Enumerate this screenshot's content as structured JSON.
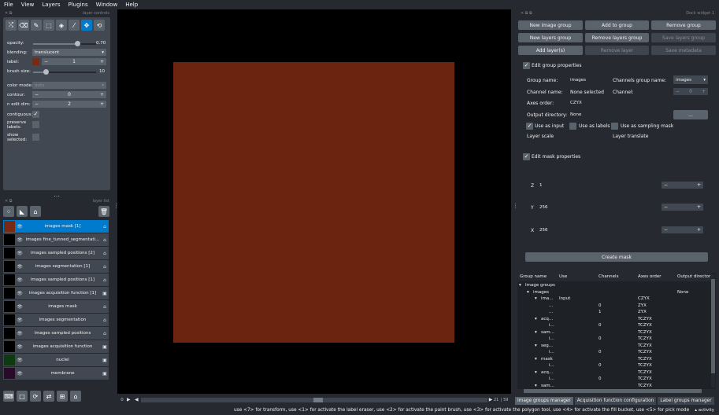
{
  "menu": [
    "File",
    "View",
    "Layers",
    "Plugins",
    "Window",
    "Help"
  ],
  "left": {
    "controls_title": "layer controls",
    "layers_title": "layer list",
    "opacity_label": "opacity:",
    "opacity_value": "0.70",
    "opacity_fraction": 0.7,
    "blending_label": "blending:",
    "blending_value": "translucent",
    "label_label": "label:",
    "label_value": "1",
    "label_color": "#7a2a12",
    "brush_label": "brush size:",
    "brush_value": "10",
    "brush_fraction": 0.2,
    "colormode_label": "color mode:",
    "colormode_value": "auto",
    "contour_label": "contour:",
    "contour_value": "0",
    "ndim_label": "n edit dim:",
    "ndim_value": "2",
    "contiguous_label": "contiguous:",
    "preserve_label": "preserve labels:",
    "show_label": "show selected:",
    "layers": [
      {
        "name": "images mask [1]",
        "type": "labels",
        "thumb": "#7a2a12",
        "selected": true
      },
      {
        "name": "images fine_tunned_segmentati...",
        "type": "labels",
        "thumb": "#000000"
      },
      {
        "name": "images sampled positions [2]",
        "type": "labels",
        "thumb": "#000000"
      },
      {
        "name": "images segmentation [1]",
        "type": "labels",
        "thumb": "#000000"
      },
      {
        "name": "images sampled positions [1]",
        "type": "labels",
        "thumb": "#000000"
      },
      {
        "name": "images acquisition function [1]",
        "type": "image",
        "thumb": "#000000"
      },
      {
        "name": "images mask",
        "type": "labels",
        "thumb": "#000000"
      },
      {
        "name": "images segmentation",
        "type": "labels",
        "thumb": "#000000"
      },
      {
        "name": "images sampled positions",
        "type": "labels",
        "thumb": "#000000"
      },
      {
        "name": "images acquisition function",
        "type": "image",
        "thumb": "#000000"
      },
      {
        "name": "nuclei",
        "type": "image",
        "thumb": "#0e3a10"
      },
      {
        "name": "membrane",
        "type": "image",
        "thumb": "#2a0a2a"
      }
    ]
  },
  "canvas": {
    "frame_label": "0",
    "slider_left": "21",
    "slider_right": "59",
    "image_color": "#6a2410"
  },
  "dock": {
    "title": "Dock widget 1",
    "buttons": {
      "new_group": "New image group",
      "add_to_group": "Add to group",
      "remove_group": "Remove group",
      "new_layers_group": "New layers group",
      "remove_layers_group": "Remove layers group",
      "save_layers_group": "Save layers group",
      "add_layers": "Add layer(s)",
      "remove_layer": "Remove layer",
      "save_metadata": "Save metadata",
      "browse": "...",
      "create_mask": "Create mask"
    },
    "edit_group_label": "Edit group properties",
    "group_name_label": "Group name:",
    "group_name_value": "images",
    "channels_group_label": "Channels group name:",
    "channels_group_value": "images",
    "channel_name_label": "Channel name:",
    "channel_name_value": "None selected",
    "channel_label": "Channel:",
    "channel_value": "0",
    "axes_order_label": "Axes order:",
    "axes_order_value": "CZYX",
    "output_dir_label": "Output directory:",
    "output_dir_value": "None",
    "use_input_label": "Use as input",
    "use_labels_label": "Use as labels",
    "use_sampling_label": "Use as sampling mask",
    "layer_scale_label": "Layer scale",
    "layer_translate_label": "Layer translate",
    "edit_mask_label": "Edit mask properties",
    "mask_z_label": "Z",
    "mask_z_value": "1",
    "mask_y_label": "Y",
    "mask_y_value": "256",
    "mask_x_label": "X",
    "mask_x_value": "256",
    "table_headers": [
      "Group name",
      "Use",
      "Channels",
      "Axes order",
      "Output director"
    ],
    "tree_rows": [
      {
        "indent": 0,
        "name": "Image groups",
        "use": "",
        "ch": "",
        "axes": "",
        "out": ""
      },
      {
        "indent": 1,
        "name": "images",
        "use": "",
        "ch": "",
        "axes": "",
        "out": "None"
      },
      {
        "indent": 2,
        "name": "ima...",
        "use": "Input",
        "ch": "",
        "axes": "CZYX",
        "out": ""
      },
      {
        "indent": 3,
        "name": "...",
        "use": "",
        "ch": "0",
        "axes": "ZYX",
        "out": ""
      },
      {
        "indent": 3,
        "name": "...",
        "use": "",
        "ch": "1",
        "axes": "ZYX",
        "out": ""
      },
      {
        "indent": 2,
        "name": "acq...",
        "use": "",
        "ch": "",
        "axes": "TCZYX",
        "out": ""
      },
      {
        "indent": 3,
        "name": "i...",
        "use": "",
        "ch": "0",
        "axes": "TCZYX",
        "out": ""
      },
      {
        "indent": 2,
        "name": "sam...",
        "use": "",
        "ch": "",
        "axes": "TCZYX",
        "out": ""
      },
      {
        "indent": 3,
        "name": "i...",
        "use": "",
        "ch": "0",
        "axes": "TCZYX",
        "out": ""
      },
      {
        "indent": 2,
        "name": "seg...",
        "use": "",
        "ch": "",
        "axes": "TCZYX",
        "out": ""
      },
      {
        "indent": 3,
        "name": "i...",
        "use": "",
        "ch": "0",
        "axes": "TCZYX",
        "out": ""
      },
      {
        "indent": 2,
        "name": "mask",
        "use": "",
        "ch": "",
        "axes": "TCZYX",
        "out": ""
      },
      {
        "indent": 3,
        "name": "i...",
        "use": "",
        "ch": "0",
        "axes": "TCZYX",
        "out": ""
      },
      {
        "indent": 2,
        "name": "acq...",
        "use": "",
        "ch": "",
        "axes": "TCZYX",
        "out": ""
      },
      {
        "indent": 3,
        "name": "i...",
        "use": "",
        "ch": "0",
        "axes": "TCZYX",
        "out": ""
      },
      {
        "indent": 2,
        "name": "sam...",
        "use": "",
        "ch": "",
        "axes": "TCZYX",
        "out": ""
      }
    ],
    "tabs": [
      "Image groups manager",
      "Acquisition function configuration",
      "Label groups manager"
    ]
  },
  "status": {
    "text": "use <7> for transform, use <1> for activate the label eraser, use <2> for activate the paint brush, use <3> for activate the polygon tool, use <4> for activate the fill bucket, use <5> for pick mode",
    "activity": "activity"
  }
}
